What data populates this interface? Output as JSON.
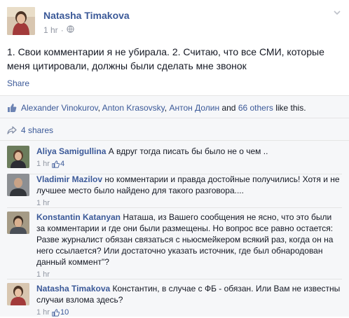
{
  "post": {
    "author": "Natasha Timakova",
    "time": "1 hr",
    "dot": "·",
    "text": "1. Свои комментарии я не убирала. 2. Считаю, что все СМИ, которые меня цитировали, должны были сделать мне звонок",
    "share_label": "Share"
  },
  "likes": {
    "people": [
      "Alexander Vinokurov",
      "Anton Krasovsky",
      "Антон Долин"
    ],
    "sep1": ", ",
    "sep2": ", ",
    "and_text": " and ",
    "others": "66 others",
    "suffix": " like this."
  },
  "shares": {
    "label": "4 shares"
  },
  "comments": [
    {
      "name": "Aliya Samigullina",
      "text": "А вдруг тогда писать бы было не о чем ..",
      "time": "1 hr",
      "likes": "4"
    },
    {
      "name": "Vladimir Mazilov",
      "text": "но комментарии и правда достойные получились! Хотя и не лучшее место было найдено для такого разговора....",
      "time": "1 hr"
    },
    {
      "name": "Konstantin Katanyan",
      "text": "Наташа, из Вашего сообщения не ясно, что это были за комментарии и где они были размещены. Но вопрос все равно остается: Разве журналист обязан связаться с ньюсмейкером всякий раз, когда он на него ссылается? Или достаточно указать источник, где был обнародован данный коммент\"?",
      "time": "1 hr"
    },
    {
      "name": "Natasha Timakova",
      "text": "Константин, в случае с ФБ - обязан. Или Вам не известны случаи взлома здесь?",
      "time": "1 hr",
      "likes": "10"
    }
  ],
  "colors": {
    "link": "#3b5998",
    "meta": "#9197a3",
    "ufi_bg": "#f6f7f9"
  }
}
